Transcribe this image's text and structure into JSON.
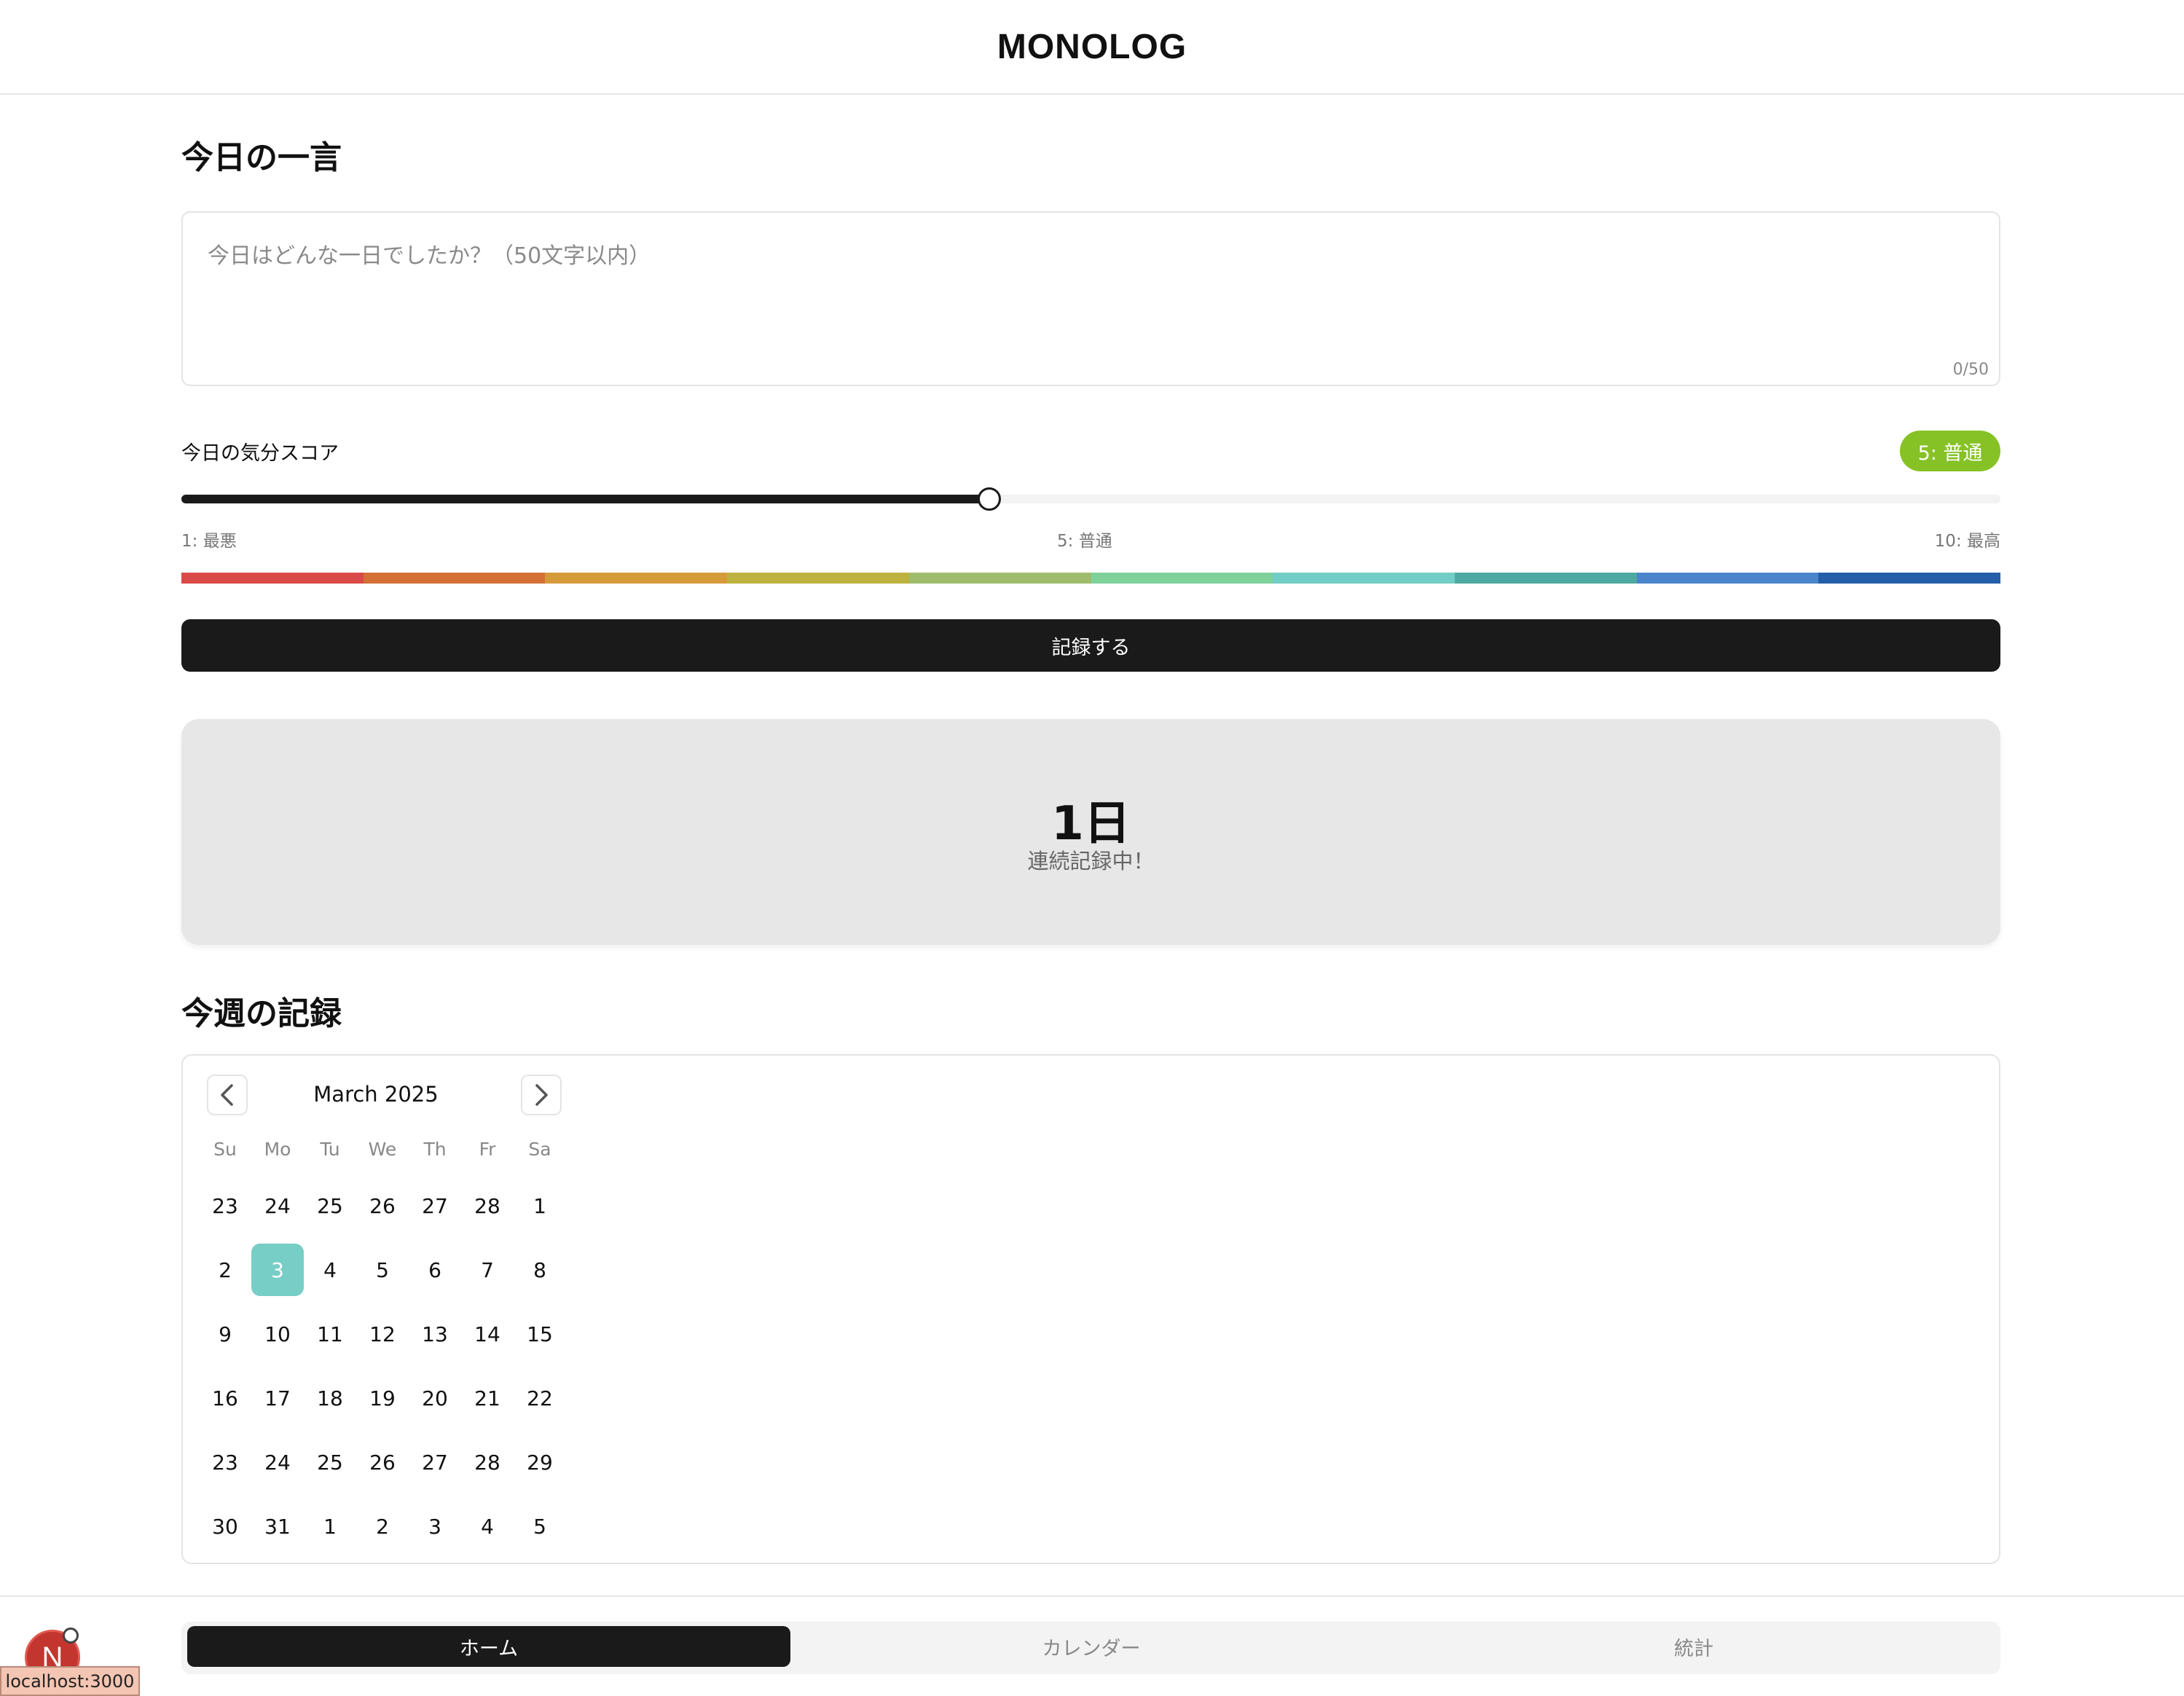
{
  "app": {
    "title": "MONOLOG"
  },
  "entry": {
    "title": "今日の一言",
    "placeholder": "今日はどんな一日でしたか？（50文字以内）",
    "value": "",
    "counter": "0/50"
  },
  "mood": {
    "label": "今日の気分スコア",
    "badge": "5: 普通",
    "badge_color": "#86c226",
    "value": 5,
    "min": 1,
    "max": 10,
    "scale_min_label": "1: 最悪",
    "scale_mid_label": "5: 普通",
    "scale_max_label": "10: 最高",
    "colors": [
      "#d94b48",
      "#d46f35",
      "#d59b3a",
      "#bdb23f",
      "#9ebc6c",
      "#7fd19a",
      "#72cdc5",
      "#4ea9a2",
      "#4a85cc",
      "#255ea8"
    ]
  },
  "record_button": "記録する",
  "streak": {
    "value": "1日",
    "caption": "連続記録中！"
  },
  "weekly": {
    "title": "今週の記録",
    "calendar": {
      "month_label": "March 2025",
      "weekdays": [
        "Su",
        "Mo",
        "Tu",
        "We",
        "Th",
        "Fr",
        "Sa"
      ],
      "weeks": [
        [
          "23",
          "24",
          "25",
          "26",
          "27",
          "28",
          "1"
        ],
        [
          "2",
          "3",
          "4",
          "5",
          "6",
          "7",
          "8"
        ],
        [
          "9",
          "10",
          "11",
          "12",
          "13",
          "14",
          "15"
        ],
        [
          "16",
          "17",
          "18",
          "19",
          "20",
          "21",
          "22"
        ],
        [
          "23",
          "24",
          "25",
          "26",
          "27",
          "28",
          "29"
        ],
        [
          "30",
          "31",
          "1",
          "2",
          "3",
          "4",
          "5"
        ]
      ],
      "selected": "3",
      "selected_color": "#76cec7"
    }
  },
  "nav": {
    "tabs": [
      "ホーム",
      "カレンダー",
      "統計"
    ],
    "active": "ホーム"
  },
  "dev": {
    "badge_letter": "N",
    "url": "localhost:3000"
  }
}
